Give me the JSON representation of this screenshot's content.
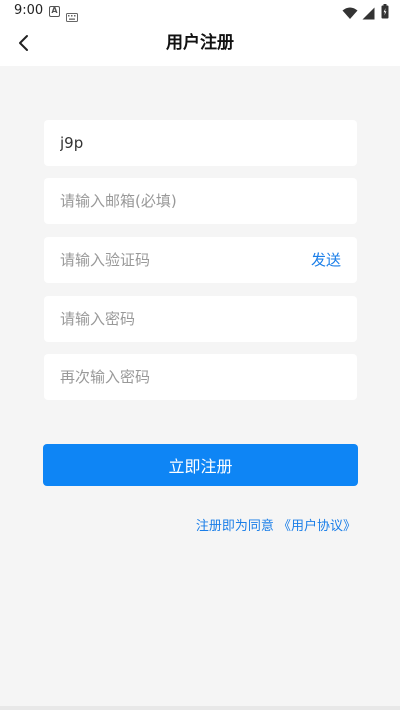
{
  "status_bar": {
    "time": "9:00",
    "icons": [
      "a-icon",
      "keyboard-icon",
      "wifi-icon",
      "signal-icon",
      "battery-icon"
    ]
  },
  "header": {
    "title": "用户注册",
    "back_icon": "chevron-left-icon"
  },
  "form": {
    "username": {
      "value": "j9p",
      "placeholder": ""
    },
    "email": {
      "value": "",
      "placeholder": "请输入邮箱(必填)"
    },
    "code": {
      "value": "",
      "placeholder": "请输入验证码",
      "send_label": "发送"
    },
    "password": {
      "value": "",
      "placeholder": "请输入密码"
    },
    "confirm_password": {
      "value": "",
      "placeholder": "再次输入密码"
    }
  },
  "actions": {
    "register_label": "立即注册"
  },
  "agreement": {
    "prefix": "注册即为同意",
    "link": "《用户协议》"
  },
  "colors": {
    "accent": "#0e85f5",
    "link": "#1a7ee8",
    "background": "#f5f5f5"
  }
}
